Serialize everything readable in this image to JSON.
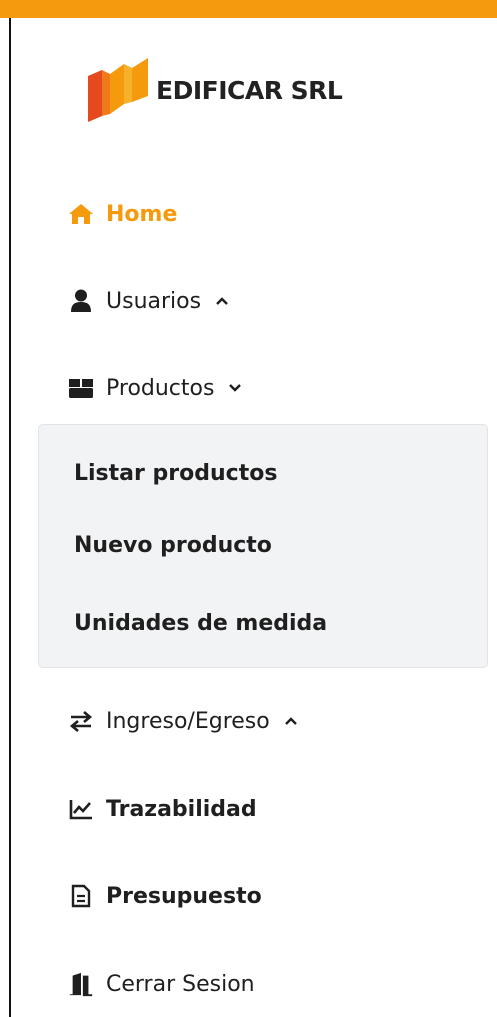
{
  "brand": {
    "name": "EDIFICAR SRL",
    "logo_icon": "building-logo-icon"
  },
  "colors": {
    "accent": "#f59a0c",
    "text": "#1f1f1f",
    "submenu_bg": "#f2f3f5"
  },
  "nav": {
    "home": {
      "label": "Home",
      "icon": "home-icon",
      "active": true
    },
    "usuarios": {
      "label": "Usuarios",
      "icon": "user-icon",
      "expanded": false
    },
    "productos": {
      "label": "Productos",
      "icon": "box-icon",
      "expanded": true,
      "subitems": [
        "Listar productos",
        "Nuevo producto",
        "Unidades de medida"
      ]
    },
    "ingreso": {
      "label": "Ingreso/Egreso",
      "icon": "exchange-icon",
      "expanded": false
    },
    "trazabilidad": {
      "label": "Trazabilidad",
      "icon": "chart-line-icon"
    },
    "presupuesto": {
      "label": "Presupuesto",
      "icon": "document-icon"
    },
    "cerrar": {
      "label": "Cerrar Sesion",
      "icon": "door-exit-icon"
    }
  }
}
